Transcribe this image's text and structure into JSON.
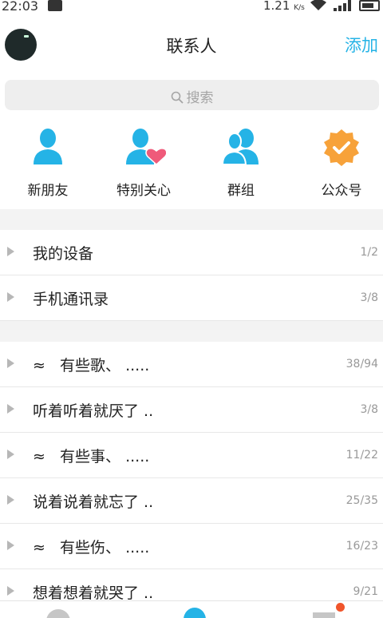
{
  "status_bar": {
    "time": "22:03",
    "speed_value": "1.21",
    "speed_unit": "K/s"
  },
  "header": {
    "title": "联系人",
    "add_label": "添加"
  },
  "search": {
    "placeholder": "搜索"
  },
  "quick_entries": [
    {
      "label": "新朋友",
      "icon": "person-icon"
    },
    {
      "label": "特别关心",
      "icon": "person-heart-icon"
    },
    {
      "label": "群组",
      "icon": "group-icon"
    },
    {
      "label": "公众号",
      "icon": "verified-badge-icon"
    }
  ],
  "colors": {
    "accent": "#25b3e6",
    "heart": "#ef5a7a",
    "badge": "#f7a23a"
  },
  "groups_top": [
    {
      "name": "我的设备",
      "count": "1/2"
    },
    {
      "name": "手机通讯录",
      "count": "3/8"
    }
  ],
  "groups_main": [
    {
      "name": "≈   有些歌、 .....",
      "count": "38/94"
    },
    {
      "name": "听着听着就厌了 ..",
      "count": "3/8"
    },
    {
      "name": "≈   有些事、 .....",
      "count": "11/22"
    },
    {
      "name": "说着说着就忘了 ..",
      "count": "25/35"
    },
    {
      "name": "≈   有些伤、 .....",
      "count": "16/23"
    },
    {
      "name": "想着想着就哭了 ..",
      "count": "9/21"
    }
  ]
}
